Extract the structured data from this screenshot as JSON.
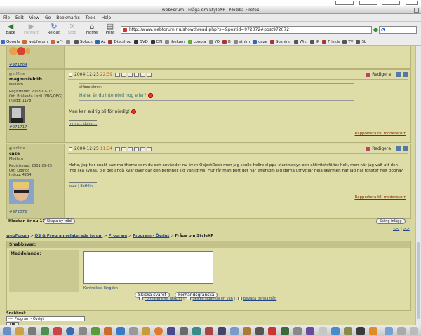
{
  "window": {
    "title": "webForum - Fråga om StyleXP - Mozilla Firefox"
  },
  "menu": [
    "File",
    "Edit",
    "View",
    "Go",
    "Bookmarks",
    "Tools",
    "Help"
  ],
  "nav": {
    "back": "Back",
    "forward": "Forward",
    "reload": "Reload",
    "stop": "Stop",
    "home": "Home",
    "print": "Print",
    "url": "http://www.webforum.nu/showthread.php?s=&postid=972072#post972072",
    "search_logo": "G"
  },
  "bookmarks": [
    "Google",
    "webforum",
    "wF-",
    "",
    "Solock",
    "Az",
    "Discshop",
    "SVD",
    "DN",
    "ihelgen",
    "Loopia",
    "YO",
    "B",
    "sthlm",
    "caze",
    "Susning",
    "Wiki",
    "IP",
    "Friskis",
    "TV",
    "SL"
  ],
  "posts": [
    {
      "status": "offline",
      "username": "magnusfeldth",
      "rank": "Medlem",
      "info": "Registrerad: 2003-01-02\nOrt: Brålanda i exil (VBG/OBG)\nInlägg: 1178",
      "postlink": "#971717",
      "date": "2004-12-23",
      "time": "22:39",
      "edit_label": "Redigera",
      "quote_by": "elfboe skrev:",
      "quote_text": "Haha, är du inte nörd nog eller?",
      "text": "Man kan aldrig bli för nördig!",
      "sig": "mmm... donut...",
      "report": "Rapportera till moderatorn"
    },
    {
      "status": "online",
      "username": "caze",
      "rank": "Medlem",
      "info": "Registrerad: 2001-09-25\nOrt: Lidingö\nInlägg: 4254",
      "postlink": "#972072",
      "date": "2004-12-25",
      "time": "11:34",
      "edit_label": "Redigera",
      "text": "Hehe, jag har exakt samma theme som du och använder nu även ObjectDock men jag skulle hellre slippa startmenyn och aktivitetsfältet helt, men när jag valt att den inte ska synas, blir det ändå kvar över där den befinner sig vanligtvis. Hur får man bort det här eftersom jag gärna utnyttjar hela skärmen när jag har fönster helt öppna?",
      "sig": "caze | Bothlin",
      "report": "Rapportera till moderatorn"
    }
  ],
  "first_postlink": "#971704",
  "clock_text": "Klockan är nu 11:34",
  "new_thread": "Skapa ny tråd",
  "close_thread": "Stäng inlägg",
  "pagination": [
    "<<",
    "|",
    ">>"
  ],
  "breadcrumb": {
    "items": [
      "webForum",
      "OS & Programrelaterade forum",
      "Program",
      "Program - Övrigt"
    ],
    "current": "Fråga om StyleXP"
  },
  "quick_reply": {
    "heading": "Snabbsvar:",
    "label": "Meddelande:",
    "check_length": "Kontrollera längden",
    "send": "Skicka svaret",
    "preview": "Förhandsgranska"
  },
  "bottom_links": {
    "print": "Formatera för utskrift",
    "email": "Skicka sidan till en vän",
    "subscribe": "Bevaka denna tråd"
  },
  "quick_nav": {
    "label": "Snabbval:",
    "selected": "---- Program - Övrigt",
    "ok": "OK"
  }
}
